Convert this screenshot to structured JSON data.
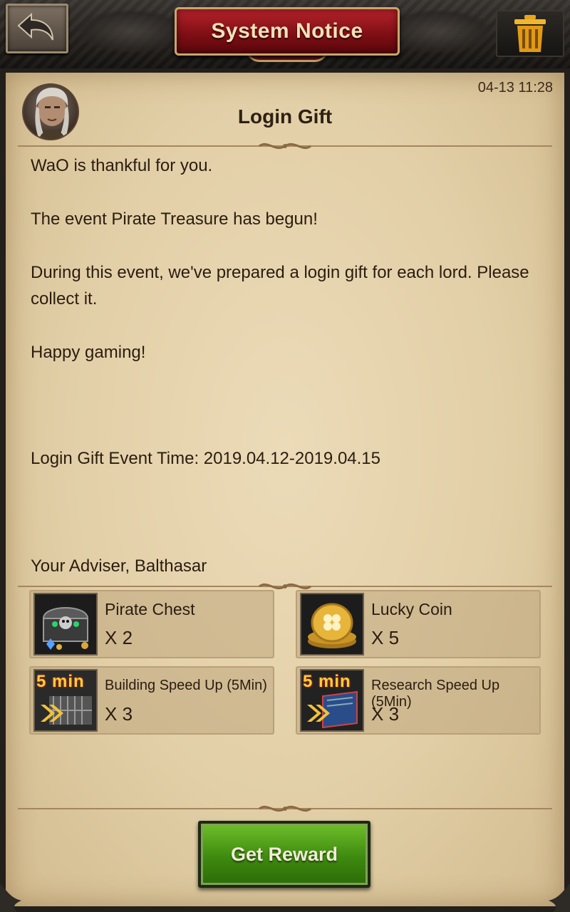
{
  "header": {
    "title": "System Notice"
  },
  "mail": {
    "timestamp": "04-13 11:28",
    "subject": "Login Gift",
    "lines": {
      "l1": "WaO is thankful for you.",
      "l2": "The event Pirate Treasure has begun!",
      "l3": "During this event, we've prepared a login gift for each lord. Please collect it.",
      "l4": "Happy gaming!",
      "l5": "Login Gift Event Time: 2019.04.12-2019.04.15",
      "signature": "Your Adviser, Balthasar"
    }
  },
  "rewards": [
    {
      "name": "Pirate Chest",
      "qty": "X 2",
      "icon": "pirate-chest-icon"
    },
    {
      "name": "Lucky Coin",
      "qty": "X 5",
      "icon": "lucky-coin-icon"
    },
    {
      "name": "Building Speed Up (5Min)",
      "qty": "X 3",
      "icon": "building-speedup-icon",
      "badge": "5 min"
    },
    {
      "name": "Research Speed Up (5Min)",
      "qty": "X 3",
      "icon": "research-speedup-icon",
      "badge": "5 min"
    }
  ],
  "actions": {
    "get_reward": "Get Reward"
  }
}
